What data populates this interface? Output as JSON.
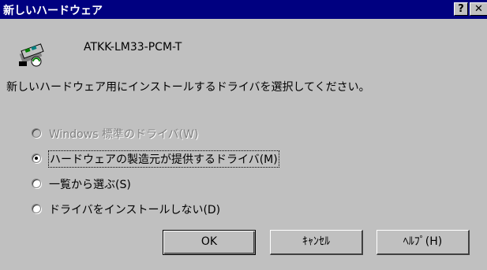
{
  "window": {
    "title": "新しいハードウェア",
    "help_glyph": "?",
    "close_glyph": "✕"
  },
  "device": {
    "icon": "hardware-device-icon",
    "name": "ATKK-LM33-PCM-T"
  },
  "instruction": "新しいハードウェア用にインストールするドライバを選択してください。",
  "options": [
    {
      "label": "Windows 標準のドライバ(W)",
      "selected": false,
      "enabled": false
    },
    {
      "label": "ハードウェアの製造元が提供するドライバ(M)",
      "selected": true,
      "enabled": true
    },
    {
      "label": "一覧から選ぶ(S)",
      "selected": false,
      "enabled": true
    },
    {
      "label": "ドライバをインストールしない(D)",
      "selected": false,
      "enabled": true
    }
  ],
  "buttons": {
    "ok": "OK",
    "cancel": "ｷｬﾝｾﾙ",
    "help": "ﾍﾙﾌﾟ(H)"
  },
  "colors": {
    "titlebar": "#000080",
    "face": "#c0c0c0",
    "disabled_text": "#808080"
  }
}
